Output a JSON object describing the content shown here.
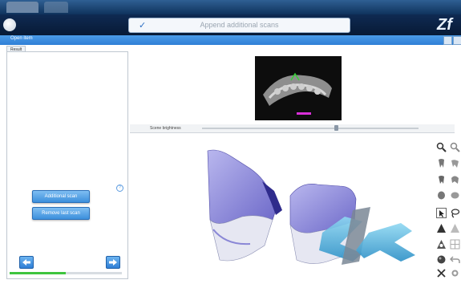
{
  "header": {
    "title_placeholder": "Append additional scans",
    "brand": "Zf"
  },
  "menubar": {
    "label": "Open item"
  },
  "left_panel": {
    "tab_label": "Result List",
    "additional_scan_label": "Additional scan",
    "remove_last_scan_label": "Remove last scan",
    "help_label": "?",
    "progress": 0.5
  },
  "preview": {
    "slider_label": "Scene brightness"
  },
  "toolbar": {
    "icons": [
      "zoom-in-icon",
      "zoom-out-icon",
      "tooth-front-icon",
      "tooth-side-icon",
      "tooth-back-icon",
      "tooth-rotate-icon",
      "select-arrow-icon",
      "lasso-icon",
      "solid-shade-icon",
      "wire-shade-icon",
      "light-icon",
      "grid-icon",
      "sphere-icon",
      "undo-icon",
      "cut-icon",
      "settings-icon"
    ]
  }
}
